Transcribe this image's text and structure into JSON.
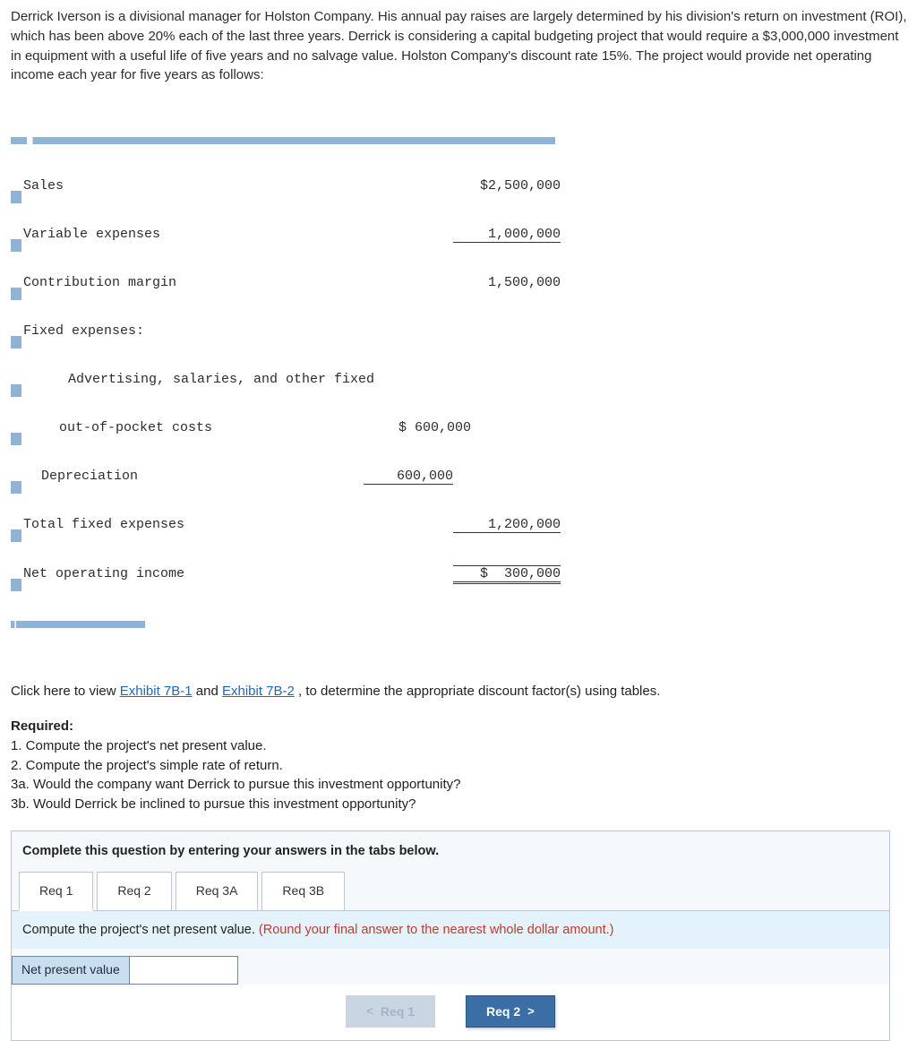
{
  "intro": "Derrick Iverson is a divisional manager for Holston Company. His annual pay raises are largely determined by his division's return on investment (ROI), which has been above 20% each of the last three years. Derrick is considering a capital budgeting project that would require a $3,000,000 investment in equipment with a useful life of five years and no salvage value. Holston Company's discount rate 15%. The project would provide net operating income each year for five years as follows:",
  "income": {
    "sales_l": "Sales",
    "sales_v": "$2,500,000",
    "varexp_l": "Variable expenses",
    "varexp_v": "1,000,000",
    "cm_l": "Contribution margin",
    "cm_v": "1,500,000",
    "fixed_h": "Fixed expenses:",
    "adv_l1": "Advertising, salaries, and other fixed",
    "adv_l2": "out-of-pocket costs",
    "adv_v": "$ 600,000",
    "dep_l": "Depreciation",
    "dep_v": "600,000",
    "totfix_l": "Total fixed expenses",
    "totfix_v": "1,200,000",
    "noi_l": "Net operating income",
    "noi_v": "$  300,000"
  },
  "exhibit": {
    "prefix": "Click here to view ",
    "link1": "Exhibit 7B-1",
    "mid": " and ",
    "link2": "Exhibit 7B-2",
    "suffix": ", to determine the appropriate discount factor(s) using tables."
  },
  "required": {
    "title": "Required:",
    "r1": "1. Compute the project's net present value.",
    "r2": "2. Compute the project's simple rate of return.",
    "r3a": "3a. Would the company want Derrick to pursue this investment opportunity?",
    "r3b": "3b. Would Derrick be inclined to pursue this investment opportunity?"
  },
  "answer": {
    "instr": "Complete this question by entering your answers in the tabs below.",
    "tabs": [
      "Req 1",
      "Req 2",
      "Req 3A",
      "Req 3B"
    ],
    "q": "Compute the project's net present value. ",
    "hint": "(Round your final answer to the nearest whole dollar amount.)",
    "rowlbl": "Net present value",
    "prev": "Req 1",
    "next": "Req 2"
  }
}
